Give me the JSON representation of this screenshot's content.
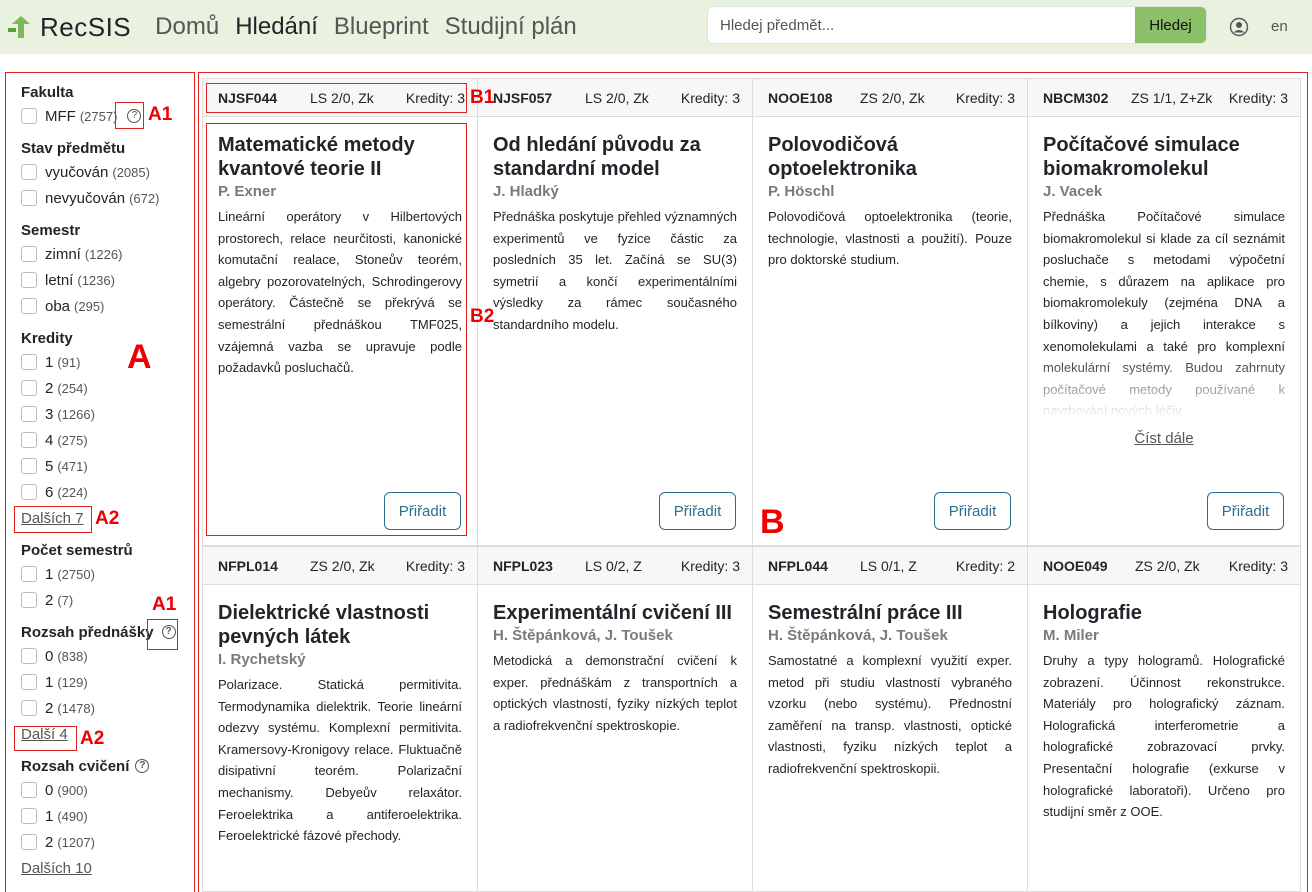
{
  "navbar": {
    "brand": "RecSIS",
    "links": [
      "Domů",
      "Hledání",
      "Blueprint",
      "Studijní plán"
    ],
    "active": "Hledání",
    "search_placeholder": "Hledej předmět...",
    "search_button": "Hledej",
    "lang": "en"
  },
  "sidebar": {
    "groups": [
      {
        "title": "Fakulta",
        "options": [
          {
            "label": "MFF",
            "count": "(2757)"
          }
        ]
      },
      {
        "title": "Stav předmětu",
        "options": [
          {
            "label": "vyučován",
            "count": "(2085)"
          },
          {
            "label": "nevyučován",
            "count": "(672)"
          }
        ]
      },
      {
        "title": "Semestr",
        "options": [
          {
            "label": "zimní",
            "count": "(1226)"
          },
          {
            "label": "letní",
            "count": "(1236)"
          },
          {
            "label": "oba",
            "count": "(295)"
          }
        ]
      },
      {
        "title": "Kredity",
        "options": [
          {
            "label": "1",
            "count": "(91)"
          },
          {
            "label": "2",
            "count": "(254)"
          },
          {
            "label": "3",
            "count": "(1266)"
          },
          {
            "label": "4",
            "count": "(275)"
          },
          {
            "label": "5",
            "count": "(471)"
          },
          {
            "label": "6",
            "count": "(224)"
          }
        ],
        "more": "Dalších 7"
      },
      {
        "title": "Počet semestrů",
        "options": [
          {
            "label": "1",
            "count": "(2750)"
          },
          {
            "label": "2",
            "count": "(7)"
          }
        ]
      },
      {
        "title": "Rozsah přednášky",
        "options": [
          {
            "label": "0",
            "count": "(838)"
          },
          {
            "label": "1",
            "count": "(129)"
          },
          {
            "label": "2",
            "count": "(1478)"
          }
        ],
        "more": "Další 4"
      },
      {
        "title": "Rozsah cvičení",
        "options": [
          {
            "label": "0",
            "count": "(900)"
          },
          {
            "label": "1",
            "count": "(490)"
          },
          {
            "label": "2",
            "count": "(1207)"
          }
        ],
        "more": "Dalších 10"
      }
    ]
  },
  "annotations": {
    "A": "A",
    "A1": "A1",
    "A2": "A2",
    "B": "B",
    "B1": "B1",
    "B2": "B2"
  },
  "cards": [
    {
      "code": "NJSF044",
      "sem": "LS 2/0, Zk",
      "credits": "Kredity: 3",
      "title": "Matematické metody kvantové teorie II",
      "teacher": "P. Exner",
      "desc": "Lineární operátory v Hilbertových prostorech, relace neurčitosti, kanonické komutační realace, Stoneův teorém, algebry pozorovatelných, Schrodingerovy operátory. Částečně se překrývá se semestrální přednáškou TMF025, vzájemná vazba se upravuje podle požadavků posluchačů.",
      "button": "Přiřadit"
    },
    {
      "code": "NJSF057",
      "sem": "LS 2/0, Zk",
      "credits": "Kredity: 3",
      "title": "Od hledání původu za standardní model",
      "teacher": "J. Hladký",
      "desc": "Přednáška poskytuje přehled významných experimentů ve fyzice částic za posledních 35 let. Začíná se SU(3) symetrií a končí experimentálními výsledky za rámec současného standardního modelu.",
      "button": "Přiřadit"
    },
    {
      "code": "NOOE108",
      "sem": "ZS 2/0, Zk",
      "credits": "Kredity: 3",
      "title": "Polovodičová optoelektronika",
      "teacher": "P. Höschl",
      "desc": "Polovodičová optoelektronika (teorie, technologie, vlastnosti a použití). Pouze pro doktorské studium.",
      "button": "Přiřadit"
    },
    {
      "code": "NBCM302",
      "sem": "ZS 1/1, Z+Zk",
      "credits": "Kredity: 3",
      "title": "Počítačové simulace biomakromolekul",
      "teacher": "J. Vacek",
      "desc": "Přednáška Počítačové simulace biomakromolekul si klade za cíl seznámit posluchače s metodami výpočetní chemie, s důrazem na aplikace pro biomakromolekuly (zejména DNA a bílkoviny) a jejich interakce s xenomolekulami a také pro komplexní molekulární systémy. Budou zahrnuty počítačové metody používané k navrhování nových léčiv",
      "read_more": "Číst dále",
      "button": "Přiřadit"
    },
    {
      "code": "NFPL014",
      "sem": "ZS 2/0, Zk",
      "credits": "Kredity: 3",
      "title": "Dielektrické vlastnosti pevných látek",
      "teacher": "I. Rychetský",
      "desc": "Polarizace. Statická permitivita. Termodynamika dielektrik. Teorie lineární odezvy systému. Komplexní permitivita. Kramersovy-Kronigovy relace. Fluktuačně disipativní teorém. Polarizační mechanismy. Debyeův relaxátor. Feroelektrika a antiferoelektrika. Feroelektrické fázové přechody."
    },
    {
      "code": "NFPL023",
      "sem": "LS 0/2, Z",
      "credits": "Kredity: 3",
      "title": "Experimentální cvičení III",
      "teacher": "H. Štěpánková, J. Toušek",
      "desc": "Metodická a demonstrační cvičení k exper. přednáškám z transportních a optických vlastností, fyziky nízkých teplot a radiofrekvenční spektroskopie."
    },
    {
      "code": "NFPL044",
      "sem": "LS 0/1, Z",
      "credits": "Kredity: 2",
      "title": "Semestrální práce III",
      "teacher": "H. Štěpánková, J. Toušek",
      "desc": "Samostatné a komplexní využití exper. metod při studiu vlastností vybraného vzorku (nebo systému). Přednostní zaměření na transp. vlastnosti, optické vlastnosti, fyziku nízkých teplot a radiofrekvenční spektroskopii."
    },
    {
      "code": "NOOE049",
      "sem": "ZS 2/0, Zk",
      "credits": "Kredity: 3",
      "title": "Holografie",
      "teacher": "M. Miler",
      "desc": "Druhy a typy hologramů. Holografické zobrazení. Účinnost rekonstrukce. Materiály pro holografický záznam. Holografická interferometrie a holografické zobrazovací prvky. Presentační holografie (exkurse v holografické laboratoři). Určeno pro studijní směr z OOE."
    }
  ]
}
